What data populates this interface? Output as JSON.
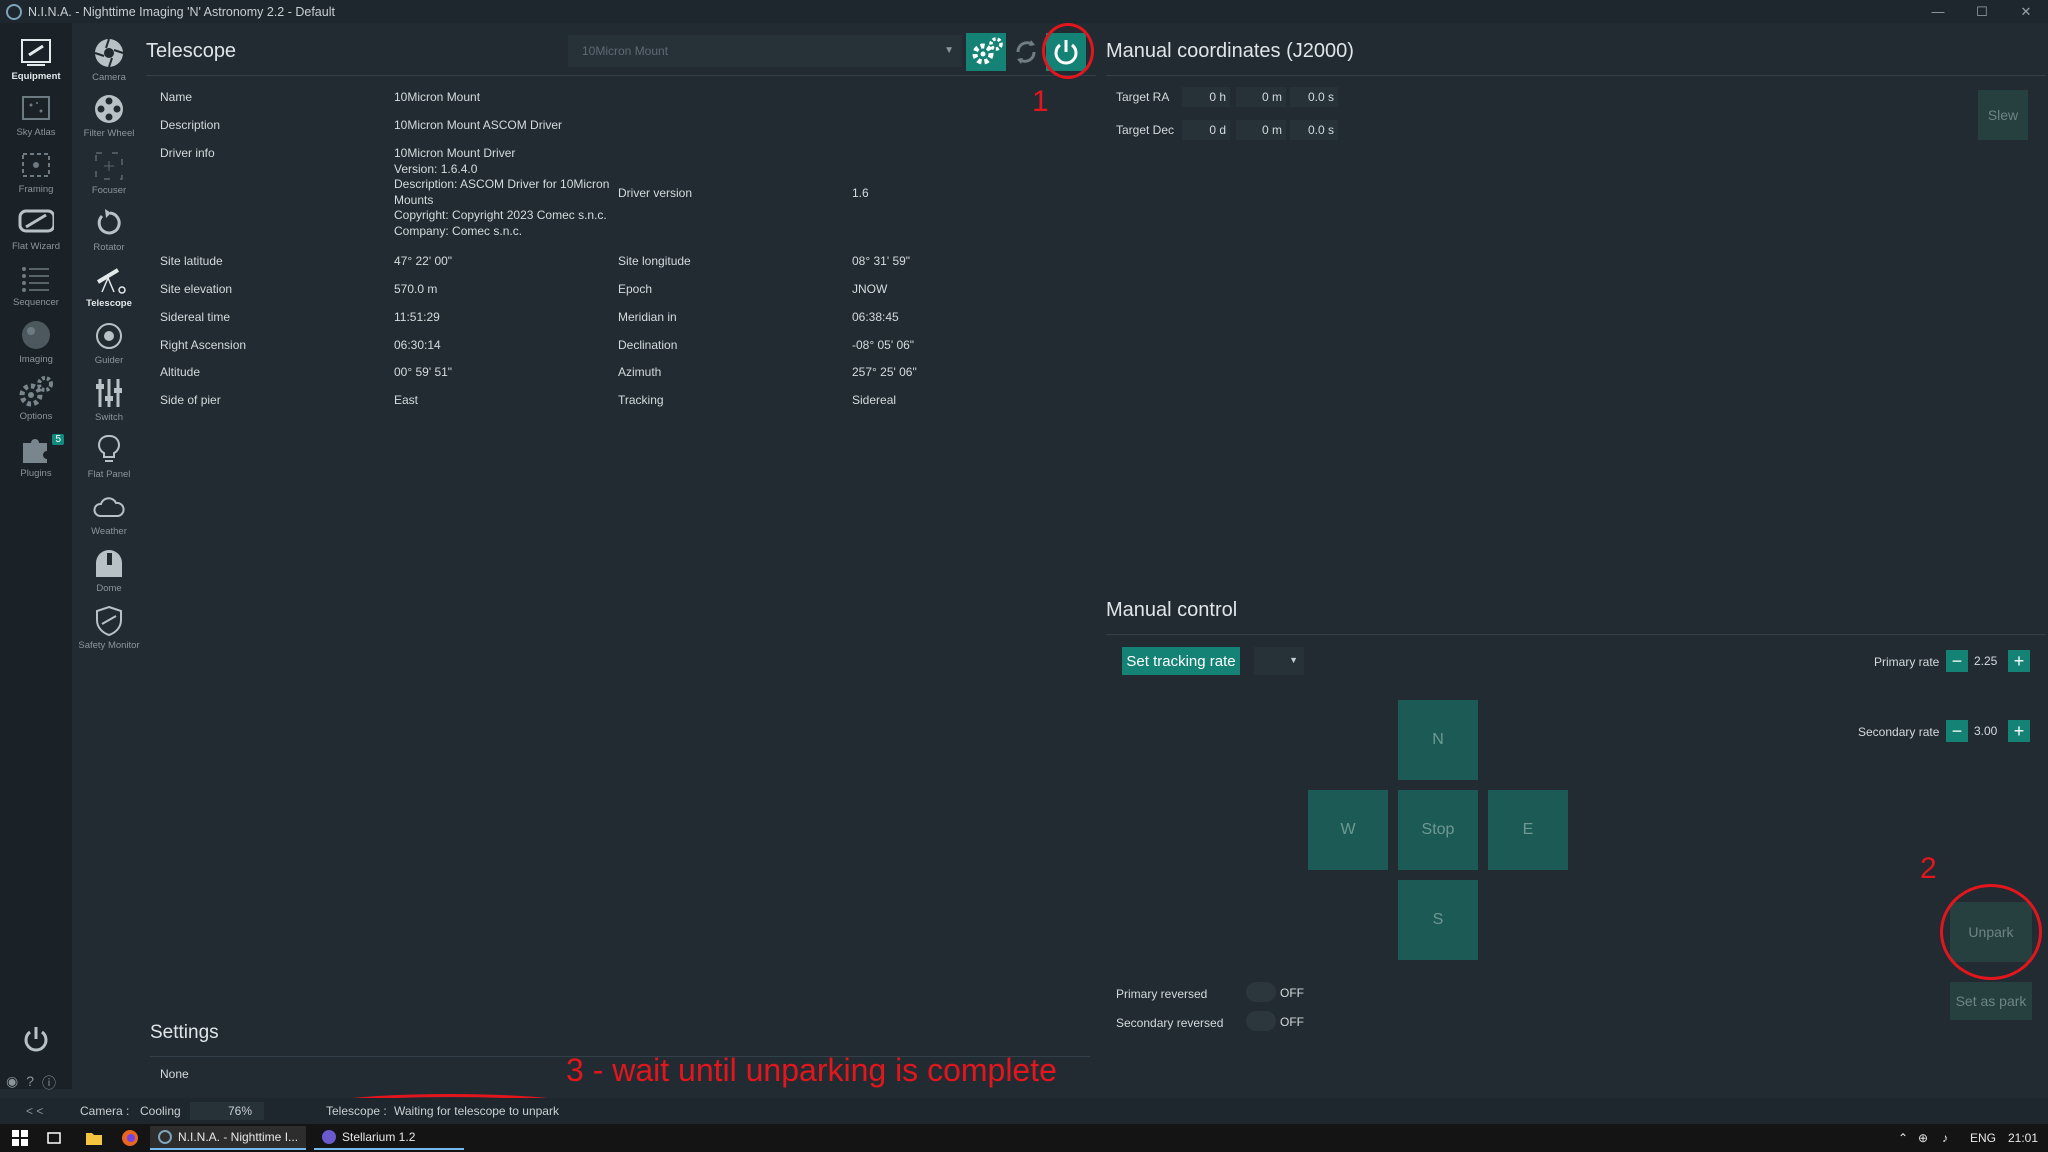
{
  "window": {
    "title": "N.I.N.A. - Nighttime Imaging 'N' Astronomy 2.2  -  Default",
    "minimize": "—",
    "maximize": "☐",
    "close": "✕"
  },
  "sidebar": {
    "items": [
      {
        "label": "Equipment",
        "icon": "equipment-icon"
      },
      {
        "label": "Sky Atlas",
        "icon": "sky-atlas-icon"
      },
      {
        "label": "Framing",
        "icon": "framing-icon"
      },
      {
        "label": "Flat Wizard",
        "icon": "flat-wizard-icon"
      },
      {
        "label": "Sequencer",
        "icon": "sequencer-icon"
      },
      {
        "label": "Imaging",
        "icon": "imaging-icon"
      },
      {
        "label": "Options",
        "icon": "gear-icon"
      },
      {
        "label": "Plugins",
        "icon": "puzzle-icon",
        "badge": "5"
      }
    ],
    "collapse": "< <"
  },
  "equipment_nav": {
    "items": [
      {
        "label": "Camera"
      },
      {
        "label": "Filter Wheel"
      },
      {
        "label": "Focuser"
      },
      {
        "label": "Rotator"
      },
      {
        "label": "Telescope"
      },
      {
        "label": "Guider"
      },
      {
        "label": "Switch"
      },
      {
        "label": "Flat Panel"
      },
      {
        "label": "Weather"
      },
      {
        "label": "Dome"
      },
      {
        "label": "Safety Monitor"
      }
    ]
  },
  "telescope": {
    "title": "Telescope",
    "device": "10Micron Mount",
    "info": {
      "name_label": "Name",
      "name": "10Micron Mount",
      "desc_label": "Description",
      "desc": "10Micron Mount ASCOM Driver",
      "driver_label": "Driver info",
      "driver_lines": [
        "10Micron Mount Driver",
        "Version: 1.6.4.0",
        "Description: ASCOM Driver for 10Micron",
        "Mounts",
        "Copyright: Copyright 2023 Comec s.n.c.",
        "Company: Comec s.n.c."
      ],
      "driver_version_label": "Driver version",
      "driver_version": "1.6",
      "lat_label": "Site latitude",
      "lat": "47° 22' 00\"",
      "lon_label": "Site longitude",
      "lon": "08° 31' 59\"",
      "elev_label": "Site elevation",
      "elev": "570.0 m",
      "epoch_label": "Epoch",
      "epoch": "JNOW",
      "sidereal_label": "Sidereal time",
      "sidereal": "11:51:29",
      "meridian_label": "Meridian in",
      "meridian": "06:38:45",
      "ra_label": "Right Ascension",
      "ra": "06:30:14",
      "dec_label": "Declination",
      "dec": "-08° 05' 06\"",
      "alt_label": "Altitude",
      "alt": "00° 59' 51\"",
      "az_label": "Azimuth",
      "az": "257° 25' 06\"",
      "pier_label": "Side of pier",
      "pier": "East",
      "tracking_label": "Tracking",
      "tracking": "Sidereal"
    }
  },
  "manual_coords": {
    "title": "Manual coordinates (J2000)",
    "ra_label": "Target RA",
    "ra": [
      "0 h",
      "0 m",
      "0.0 s"
    ],
    "dec_label": "Target Dec",
    "dec": [
      "0 d",
      "0 m",
      "0.0 s"
    ],
    "slew": "Slew"
  },
  "manual_control": {
    "title": "Manual control",
    "set_tracking": "Set tracking rate",
    "primary_rate_label": "Primary rate",
    "primary_rate": "2.25",
    "secondary_rate_label": "Secondary rate",
    "secondary_rate": "3.00",
    "n": "N",
    "w": "W",
    "stop": "Stop",
    "e": "E",
    "s": "S",
    "unpark": "Unpark",
    "set_park": "Set as park",
    "primary_reversed_label": "Primary reversed",
    "primary_reversed": "OFF",
    "secondary_reversed_label": "Secondary reversed",
    "secondary_reversed": "OFF"
  },
  "settings": {
    "title": "Settings",
    "value": "None"
  },
  "annotations": {
    "n1": "1",
    "n2": "2",
    "n3": "3 - wait until unparking is complete"
  },
  "status": {
    "camera_label": "Camera :",
    "camera_status": "Cooling",
    "progress": "76%",
    "telescope_label": "Telescope :",
    "telescope_status": "Waiting for telescope to unpark"
  },
  "taskbar": {
    "nina": "N.I.N.A. - Nighttime I...",
    "stellarium": "Stellarium 1.2",
    "lang": "ENG",
    "time": "21:01"
  },
  "colors": {
    "accent": "#148275",
    "annotation": "#e3161d"
  }
}
